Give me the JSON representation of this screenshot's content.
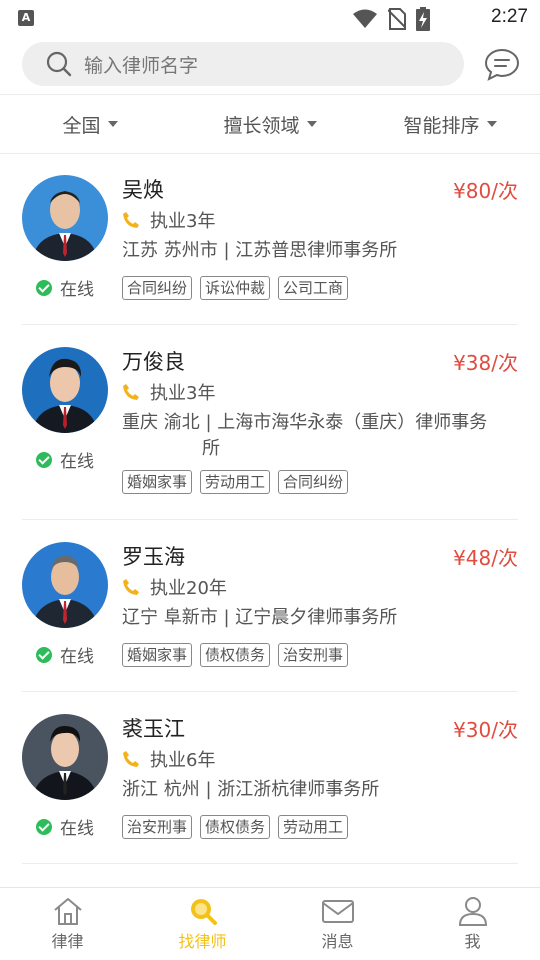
{
  "status_bar": {
    "notification_letter": "A",
    "time": "2:27",
    "icons": [
      "wifi-icon",
      "no-sim-icon",
      "battery-charging-icon"
    ]
  },
  "search": {
    "placeholder": "输入律师名字",
    "icon": "search-icon",
    "message_icon": "chat-bubble-icon"
  },
  "filters": [
    {
      "label": "全国"
    },
    {
      "label": "擅长领域"
    },
    {
      "label": "智能排序"
    }
  ],
  "lawyers": [
    {
      "name": "吴焕",
      "price": "¥80/次",
      "years": "执业3年",
      "firm_line1": "江苏 苏州市 | 江苏普思律师事务所",
      "firm_line2": "",
      "status": "在线",
      "tags": [
        "合同纠纷",
        "诉讼仲裁",
        "公司工商"
      ],
      "avatar_bg": "#3b8fd8"
    },
    {
      "name": "万俊良",
      "price": "¥38/次",
      "years": "执业3年",
      "firm_line1": "重庆 渝北 | 上海市海华永泰（重庆）律师事务",
      "firm_line2": "所",
      "status": "在线",
      "tags": [
        "婚姻家事",
        "劳动用工",
        "合同纠纷"
      ],
      "avatar_bg": "#1f6fbf"
    },
    {
      "name": "罗玉海",
      "price": "¥48/次",
      "years": "执业20年",
      "firm_line1": "辽宁 阜新市 | 辽宁晨夕律师事务所",
      "firm_line2": "",
      "status": "在线",
      "tags": [
        "婚姻家事",
        "债权债务",
        "治安刑事"
      ],
      "avatar_bg": "#2a7ad0"
    },
    {
      "name": "裘玉江",
      "price": "¥30/次",
      "years": "执业6年",
      "firm_line1": "浙江 杭州 | 浙江浙杭律师事务所",
      "firm_line2": "",
      "status": "在线",
      "tags": [
        "治安刑事",
        "债权债务",
        "劳动用工"
      ],
      "avatar_bg": "#4a5360"
    }
  ],
  "bottom_nav": [
    {
      "label": "律律",
      "icon": "home-icon",
      "active": false
    },
    {
      "label": "找律师",
      "icon": "search-icon",
      "active": true
    },
    {
      "label": "消息",
      "icon": "mail-icon",
      "active": false
    },
    {
      "label": "我",
      "icon": "user-icon",
      "active": false
    }
  ],
  "colors": {
    "accent": "#f3c21a",
    "price": "#e04c40",
    "online": "#2ebc5a"
  }
}
